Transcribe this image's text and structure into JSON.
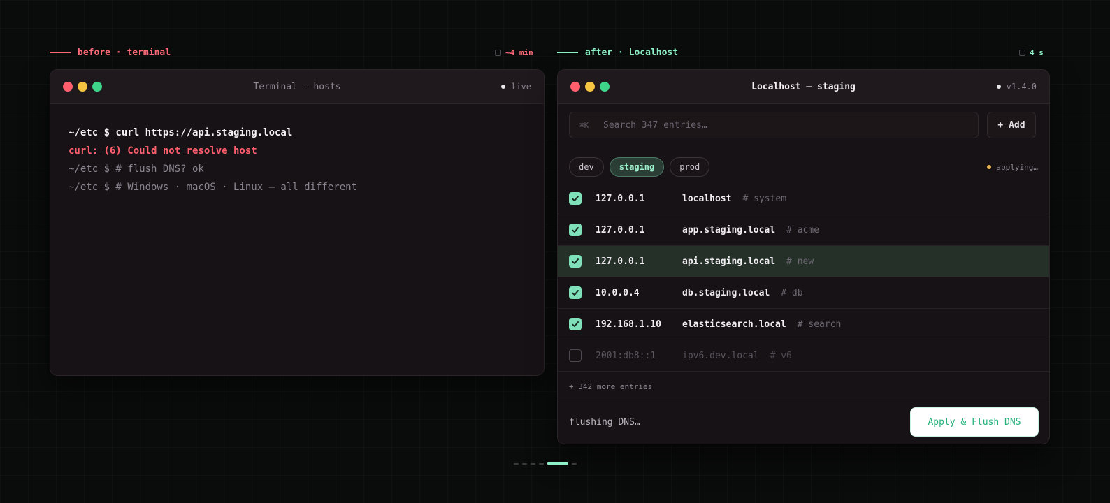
{
  "colors": {
    "before_accent": "#ff6b7a",
    "after_accent": "#8ef0c6",
    "background": "#0a0c0b",
    "window_bg": "#171215",
    "error": "#ff5f6d",
    "check": "#7fe0b9"
  },
  "left_caption": {
    "label": "before · terminal",
    "meta": "~4 min"
  },
  "right_caption": {
    "label": "after · Localhost",
    "meta": "4 s"
  },
  "terminal": {
    "title": "Terminal — hosts",
    "status": "live",
    "lines": [
      {
        "text": "~/etc $ curl https://api.staging.local",
        "kind": "command"
      },
      {
        "text": "curl: (6) Could not resolve host",
        "kind": "error"
      },
      {
        "text": "~/etc $ # flush DNS? ok",
        "kind": "comment"
      },
      {
        "text": "~/etc $ # Windows · macOS · Linux — all different",
        "kind": "comment"
      }
    ]
  },
  "app": {
    "title": "Localhost — staging",
    "version": "v1.4.0",
    "search": {
      "shortcut": "⌘K",
      "placeholder": "Search 347 entries…"
    },
    "add_label": "+ Add",
    "filters": [
      "dev",
      "staging",
      "prod"
    ],
    "active_filter": "staging",
    "applying_label": "applying…",
    "entries": [
      {
        "enabled": true,
        "ip": "127.0.0.1",
        "host": "localhost",
        "comment": "# system",
        "highlight": false
      },
      {
        "enabled": true,
        "ip": "127.0.0.1",
        "host": "app.staging.local",
        "comment": "# acme",
        "highlight": false
      },
      {
        "enabled": true,
        "ip": "127.0.0.1",
        "host": "api.staging.local",
        "comment": "# new",
        "highlight": true
      },
      {
        "enabled": true,
        "ip": "10.0.0.4",
        "host": "db.staging.local",
        "comment": "# db",
        "highlight": false
      },
      {
        "enabled": true,
        "ip": "192.168.1.10",
        "host": "elasticsearch.local",
        "comment": "# search",
        "highlight": false
      },
      {
        "enabled": false,
        "ip": "2001:db8::1",
        "host": "ipv6.dev.local",
        "comment": "# v6",
        "highlight": false
      }
    ],
    "more_label": "+ 342 more entries",
    "footer_status": "flushing DNS…",
    "apply_label": "Apply & Flush DNS"
  },
  "pager": {
    "count": 5,
    "active_index": 4
  }
}
